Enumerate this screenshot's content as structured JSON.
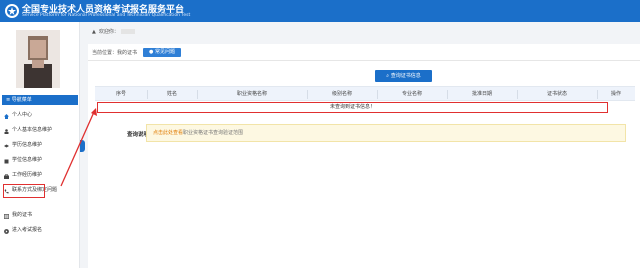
{
  "header": {
    "title_cn": "全国专业技术人员资格考试报名服务平台",
    "title_en": "Service Platform for National Professional and Technician Qualification Test"
  },
  "sidebar": {
    "nav_head": "导航菜单",
    "items": [
      {
        "label": "个人中心",
        "icon": "home-icon"
      },
      {
        "label": "个人基本信息维护",
        "icon": "user-icon"
      },
      {
        "label": "学历信息维护",
        "icon": "graduation-cap-icon"
      },
      {
        "label": "学位信息维护",
        "icon": "book-icon"
      },
      {
        "label": "工作经历维护",
        "icon": "briefcase-icon"
      },
      {
        "label": "联系方式及绑定问题",
        "icon": "phone-icon"
      },
      {
        "label": "我的证书",
        "icon": "certificate-icon"
      },
      {
        "label": "进入考试报名",
        "icon": "arrow-circle-icon"
      }
    ]
  },
  "welcome": "欢迎你：",
  "breadcrumb": {
    "prefix": "当前位置：",
    "current": "我的证书"
  },
  "faq_button": "常见问题",
  "query_button": "查询证书信息",
  "table": {
    "columns": [
      "序号",
      "姓名",
      "职业资格名称",
      "级别名称",
      "专业名称",
      "批准日期",
      "证书状态",
      "操作"
    ],
    "empty_message": "未查询到证书信息！"
  },
  "query_note": {
    "label": "查询说明",
    "link_text": "点击此处查看",
    "rest_text": "职业资格证书查询验证范围"
  },
  "colors": {
    "primary": "#1b6fc9",
    "highlight": "#e03030",
    "notice_bg": "#fdf8e2"
  }
}
